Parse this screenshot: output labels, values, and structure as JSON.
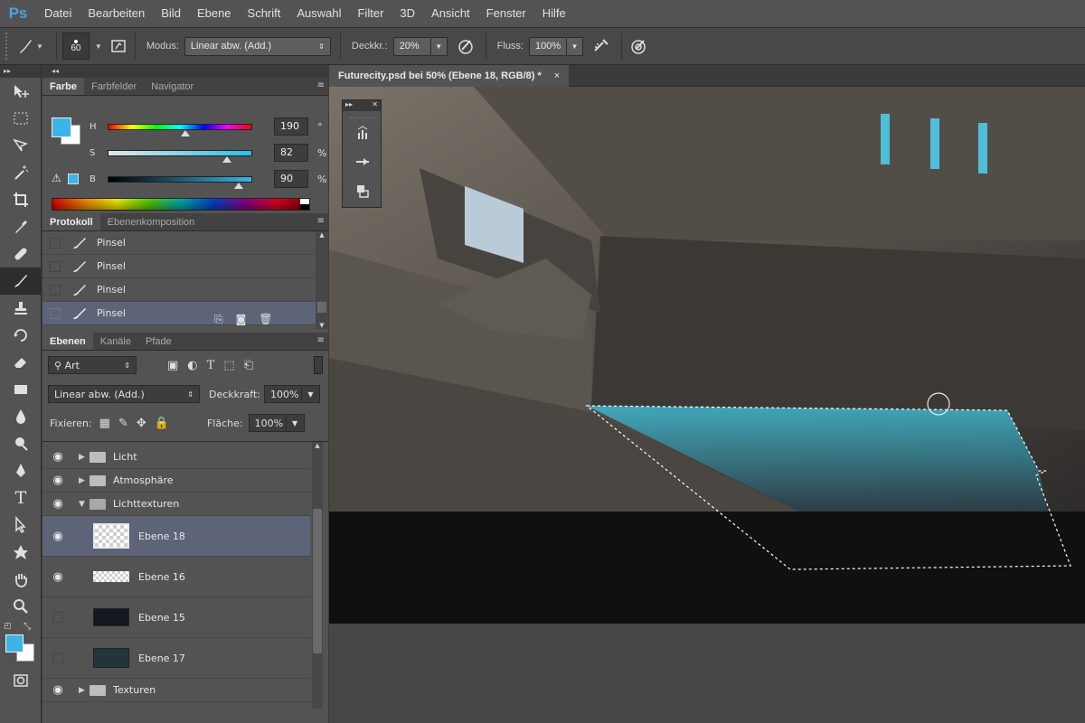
{
  "app": {
    "logo": "Ps"
  },
  "menu": [
    "Datei",
    "Bearbeiten",
    "Bild",
    "Ebene",
    "Schrift",
    "Auswahl",
    "Filter",
    "3D",
    "Ansicht",
    "Fenster",
    "Hilfe"
  ],
  "options": {
    "brush_size": "60",
    "mode_label": "Modus:",
    "mode_value": "Linear abw. (Add.)",
    "opacity_label": "Deckkr.:",
    "opacity_value": "20%",
    "flow_label": "Fluss:",
    "flow_value": "100%"
  },
  "color_panel": {
    "tabs": [
      "Farbe",
      "Farbfelder",
      "Navigator"
    ],
    "sliders": [
      {
        "label": "H",
        "value": "190",
        "unit": "°",
        "pos": 0.53
      },
      {
        "label": "S",
        "value": "82",
        "unit": "%",
        "pos": 0.82
      },
      {
        "label": "B",
        "value": "90",
        "unit": "%",
        "pos": 0.9
      }
    ],
    "fg_color": "#3cb4e5",
    "bg_color": "#ffffff"
  },
  "history_panel": {
    "tabs": [
      "Protokoll",
      "Ebenenkomposition"
    ],
    "items": [
      "Pinsel",
      "Pinsel",
      "Pinsel",
      "Pinsel"
    ],
    "active_index": 3
  },
  "layers_panel": {
    "tabs": [
      "Ebenen",
      "Kanäle",
      "Pfade"
    ],
    "filter_label": "Art",
    "blend_mode": "Linear abw. (Add.)",
    "opacity_label": "Deckkraft:",
    "opacity_value": "100%",
    "lock_label": "Fixieren:",
    "fill_label": "Fläche:",
    "fill_value": "100%",
    "layers": [
      {
        "name": "Licht",
        "type": "group",
        "visible": true,
        "expanded": false
      },
      {
        "name": "Atmosphäre",
        "type": "group",
        "visible": true,
        "expanded": false
      },
      {
        "name": "Lichttexturen",
        "type": "group",
        "visible": true,
        "expanded": true
      },
      {
        "name": "Ebene 18",
        "type": "layer",
        "visible": true,
        "active": true
      },
      {
        "name": "Ebene 16",
        "type": "layer",
        "visible": true
      },
      {
        "name": "Ebene 15",
        "type": "layer",
        "visible": false
      },
      {
        "name": "Ebene 17",
        "type": "layer",
        "visible": false
      },
      {
        "name": "Texturen",
        "type": "group",
        "visible": true,
        "expanded": false
      }
    ]
  },
  "document": {
    "tab_title": "Futurecity.psd bei 50% (Ebene 18, RGB/8) *"
  }
}
